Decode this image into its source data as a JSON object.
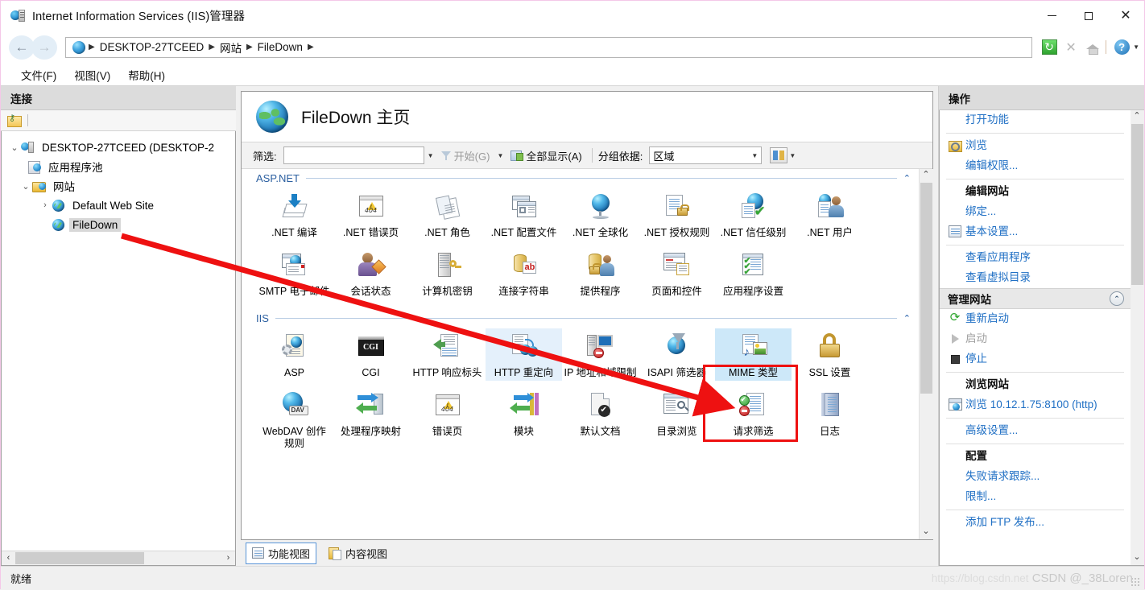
{
  "window": {
    "title": "Internet Information Services (IIS)管理器",
    "app_icon": "iis-server-icon",
    "minimize": "—",
    "maximize": "□",
    "close": "✕"
  },
  "addressbar": {
    "back_icon": "arrow-left-icon",
    "forward_icon": "arrow-right-icon",
    "breadcrumbs": [
      "DESKTOP-27TCEED",
      "网站",
      "FileDown"
    ],
    "separator": "▶",
    "buttons": [
      {
        "name": "refresh-button",
        "icon": "refresh-icon"
      },
      {
        "name": "stop-button",
        "icon": "stop-icon"
      },
      {
        "name": "home-button",
        "icon": "home-icon"
      },
      {
        "name": "help-button",
        "icon": "help-icon"
      }
    ]
  },
  "menubar": {
    "items": [
      "文件(F)",
      "视图(V)",
      "帮助(H)"
    ]
  },
  "connections": {
    "header": "连接",
    "toolbar_icon": "connect-to-server-icon",
    "tree": [
      {
        "label": "DESKTOP-27TCEED (DESKTOP-2",
        "indent": 0,
        "twisty": "v",
        "icon": "server-icon",
        "selected": false
      },
      {
        "label": "应用程序池",
        "indent": 1,
        "twisty": "",
        "icon": "app-pool-icon",
        "selected": false
      },
      {
        "label": "网站",
        "indent": 1,
        "twisty": "v",
        "icon": "sites-folder-icon",
        "selected": false
      },
      {
        "label": "Default Web Site",
        "indent": 2,
        "twisty": ">",
        "icon": "site-icon",
        "selected": false
      },
      {
        "label": "FileDown",
        "indent": 2,
        "twisty": "",
        "icon": "site-icon",
        "selected": true
      }
    ],
    "hscroll": {
      "left": "‹",
      "right": "›"
    }
  },
  "page": {
    "title": "FileDown 主页",
    "icon": "globe-icon"
  },
  "filterbar": {
    "filter_label": "筛选:",
    "filter_value": "",
    "filter_placeholder": "",
    "go_label": "开始(G)",
    "go_icon": "funnel-icon",
    "showall_label": "全部显示(A)",
    "showall_icon": "show-all-icon",
    "groupby_label": "分组依据:",
    "groupby_value": "区域",
    "viewmode_icon": "view-mode-icon",
    "dropdown_caret": "▾"
  },
  "groups": [
    {
      "name": "ASP.NET",
      "collapse_icon": "chevron-up-icon",
      "rows": [
        [
          {
            "label": ".NET 编译",
            "icon": "net-compilation-icon",
            "state": "normal"
          },
          {
            "label": ".NET 错误页",
            "icon": "net-error-pages-icon",
            "state": "normal"
          },
          {
            "label": ".NET 角色",
            "icon": "net-roles-icon",
            "state": "normal"
          },
          {
            "label": ".NET 配置文件",
            "icon": "net-profile-icon",
            "state": "normal"
          },
          {
            "label": ".NET 全球化",
            "icon": "net-globalization-icon",
            "state": "normal"
          },
          {
            "label": ".NET 授权规则",
            "icon": "net-authorization-rules-icon",
            "state": "normal"
          },
          {
            "label": ".NET 信任级别",
            "icon": "net-trust-levels-icon",
            "state": "normal"
          },
          {
            "label": ".NET 用户",
            "icon": "net-users-icon",
            "state": "normal"
          }
        ],
        [
          {
            "label": "SMTP 电子邮件",
            "icon": "smtp-email-icon",
            "state": "normal"
          },
          {
            "label": "会话状态",
            "icon": "session-state-icon",
            "state": "normal"
          },
          {
            "label": "计算机密钥",
            "icon": "machine-key-icon",
            "state": "normal"
          },
          {
            "label": "连接字符串",
            "icon": "connection-strings-icon",
            "state": "normal"
          },
          {
            "label": "提供程序",
            "icon": "providers-icon",
            "state": "normal"
          },
          {
            "label": "页面和控件",
            "icon": "pages-and-controls-icon",
            "state": "normal"
          },
          {
            "label": "应用程序设置",
            "icon": "application-settings-icon",
            "state": "normal"
          }
        ]
      ]
    },
    {
      "name": "IIS",
      "collapse_icon": "chevron-up-icon",
      "rows": [
        [
          {
            "label": "ASP",
            "icon": "asp-icon",
            "state": "normal"
          },
          {
            "label": "CGI",
            "icon": "cgi-icon",
            "state": "normal"
          },
          {
            "label": "HTTP 响应标头",
            "icon": "http-response-headers-icon",
            "state": "normal"
          },
          {
            "label": "HTTP 重定向",
            "icon": "http-redirect-icon",
            "state": "hover"
          },
          {
            "label": "IP 地址和域限制",
            "icon": "ip-address-domain-restrictions-icon",
            "state": "normal"
          },
          {
            "label": "ISAPI 筛选器",
            "icon": "isapi-filters-icon",
            "state": "normal"
          },
          {
            "label": "MIME 类型",
            "icon": "mime-types-icon",
            "state": "selected"
          },
          {
            "label": "SSL 设置",
            "icon": "ssl-settings-icon",
            "state": "normal"
          }
        ],
        [
          {
            "label": "WebDAV 创作规则",
            "icon": "webdav-authoring-rules-icon",
            "state": "normal"
          },
          {
            "label": "处理程序映射",
            "icon": "handler-mappings-icon",
            "state": "normal"
          },
          {
            "label": "错误页",
            "icon": "error-pages-icon",
            "state": "normal"
          },
          {
            "label": "模块",
            "icon": "modules-icon",
            "state": "normal"
          },
          {
            "label": "默认文档",
            "icon": "default-document-icon",
            "state": "normal"
          },
          {
            "label": "目录浏览",
            "icon": "directory-browsing-icon",
            "state": "normal"
          },
          {
            "label": "请求筛选",
            "icon": "request-filtering-icon",
            "state": "normal"
          },
          {
            "label": "日志",
            "icon": "logging-icon",
            "state": "normal"
          }
        ]
      ]
    }
  ],
  "viewtabs": [
    {
      "label": "功能视图",
      "icon": "features-view-icon",
      "active": true
    },
    {
      "label": "内容视图",
      "icon": "content-view-icon",
      "active": false
    }
  ],
  "actions": {
    "header": "操作",
    "sections": [
      {
        "title": null,
        "items": [
          {
            "label": "打开功能",
            "icon": null,
            "style": "link"
          },
          {
            "divider": true
          },
          {
            "label": "浏览",
            "icon": "browse-folder-icon",
            "style": "link"
          },
          {
            "label": "编辑权限...",
            "icon": null,
            "style": "link"
          },
          {
            "divider": true
          },
          {
            "label": "编辑网站",
            "icon": null,
            "style": "heading"
          },
          {
            "label": "绑定...",
            "icon": null,
            "style": "link"
          },
          {
            "label": "基本设置...",
            "icon": "basic-settings-icon",
            "style": "link"
          },
          {
            "divider": true
          },
          {
            "label": "查看应用程序",
            "icon": null,
            "style": "link"
          },
          {
            "label": "查看虚拟目录",
            "icon": null,
            "style": "link"
          }
        ]
      },
      {
        "title": "管理网站",
        "collapse_icon": "chevron-up-icon",
        "items": [
          {
            "label": "重新启动",
            "icon": "restart-icon",
            "style": "link"
          },
          {
            "label": "启动",
            "icon": "start-icon",
            "style": "disabled"
          },
          {
            "label": "停止",
            "icon": "stop-square-icon",
            "style": "link"
          },
          {
            "divider": true
          },
          {
            "label": "浏览网站",
            "icon": null,
            "style": "heading"
          },
          {
            "label": "浏览 10.12.1.75:8100 (http)",
            "icon": "browse-website-icon",
            "style": "link"
          },
          {
            "divider": true
          },
          {
            "label": "高级设置...",
            "icon": null,
            "style": "link"
          },
          {
            "divider": true
          },
          {
            "label": "配置",
            "icon": null,
            "style": "heading"
          },
          {
            "label": "失败请求跟踪...",
            "icon": null,
            "style": "link"
          },
          {
            "label": "限制...",
            "icon": null,
            "style": "link"
          },
          {
            "divider": true
          },
          {
            "label": "添加 FTP 发布...",
            "icon": null,
            "style": "link"
          }
        ]
      }
    ],
    "scroll": {
      "up": "⌃",
      "down": "⌄"
    }
  },
  "statusbar": {
    "text": "就绪"
  },
  "annotations": {
    "highlight_box": "red-rectangle-around-mime-types",
    "arrow": "red-arrow-from-filedown-to-mime-types"
  },
  "watermark": {
    "url": "https://blog.csdn.net",
    "text": "CSDN @_38Loren"
  },
  "colors": {
    "accent_link": "#1f6fc4",
    "group_header": "#2b5fa0",
    "selection": "#cde8f9",
    "hover": "#e4f0fb",
    "annotation_red": "#ee1111"
  }
}
